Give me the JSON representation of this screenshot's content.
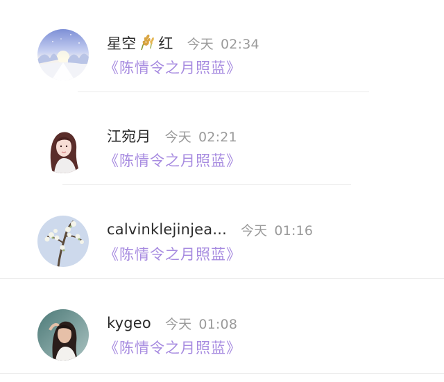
{
  "comments": [
    {
      "name_before": "星空",
      "name_icon": "wheat-icon",
      "name_after": "红",
      "day": "今天",
      "time": "02:34",
      "drama": "《陈情令之月照蓝》",
      "avatar": "snowy-landscape-avatar"
    },
    {
      "name_before": "江宛月",
      "name_icon": "",
      "name_after": "",
      "day": "今天",
      "time": "02:21",
      "drama": "《陈情令之月照蓝》",
      "avatar": "girl-portrait-avatar"
    },
    {
      "name_before": "calvinklejinjea...",
      "name_icon": "",
      "name_after": "",
      "day": "今天",
      "time": "01:16",
      "drama": "《陈情令之月照蓝》",
      "avatar": "blossom-branch-avatar"
    },
    {
      "name_before": "kygeo",
      "name_icon": "",
      "name_after": "",
      "day": "今天",
      "time": "01:08",
      "drama": "《陈情令之月照蓝》",
      "avatar": "girl-outdoor-avatar"
    }
  ],
  "colors": {
    "name": "#2b2b2b",
    "timestamp": "#9a9a9a",
    "drama_link": "#a78be0",
    "divider": "#ebebeb"
  }
}
